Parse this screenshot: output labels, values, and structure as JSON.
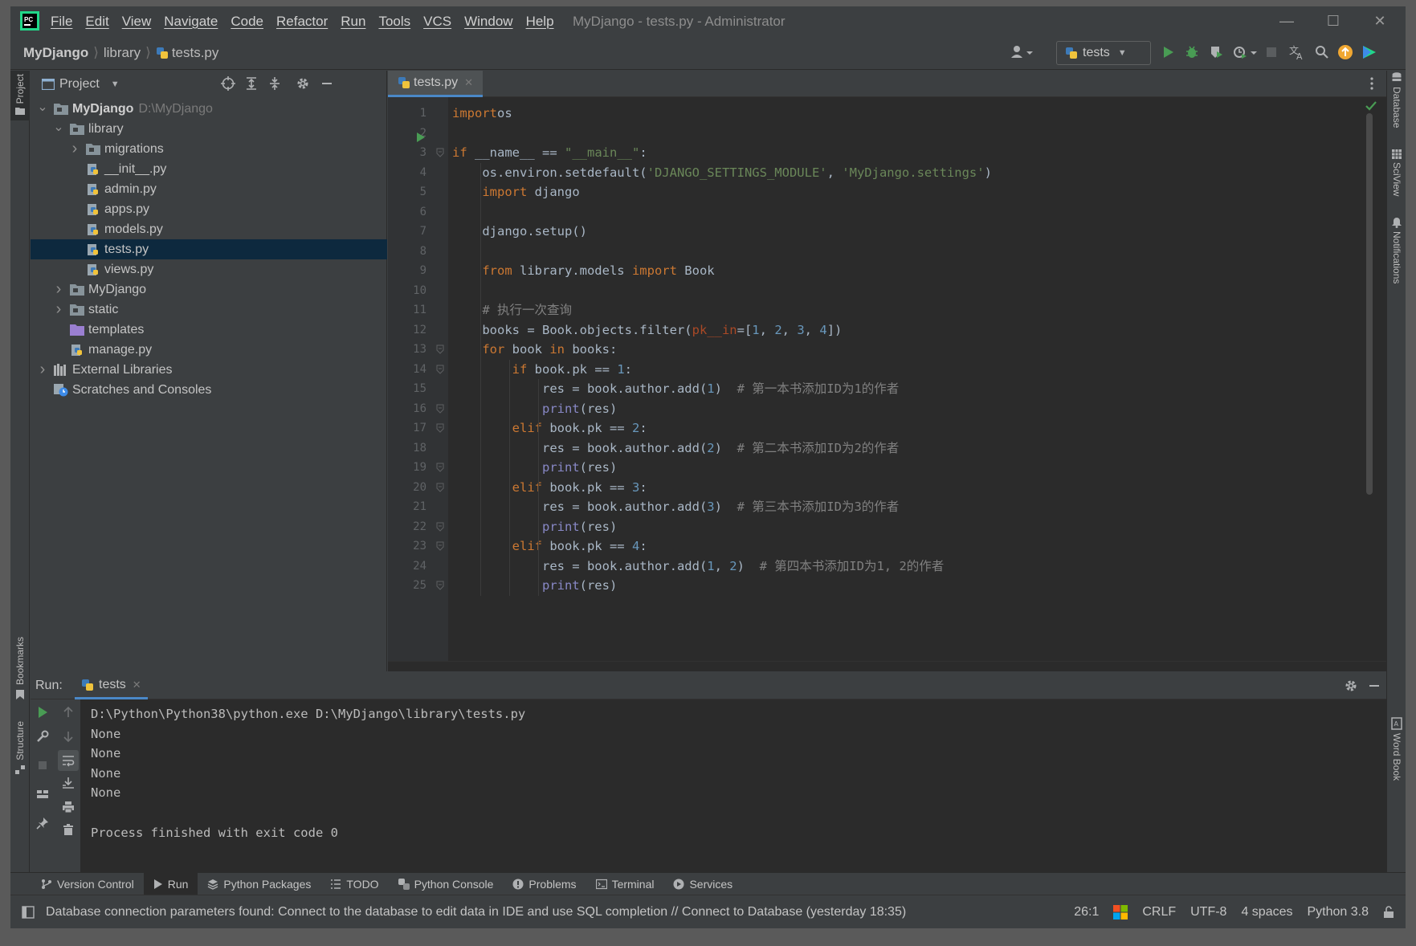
{
  "menu": [
    "File",
    "Edit",
    "View",
    "Navigate",
    "Code",
    "Refactor",
    "Run",
    "Tools",
    "VCS",
    "Window",
    "Help"
  ],
  "window_title": "MyDjango - tests.py - Administrator",
  "breadcrumb": [
    "MyDjango",
    "library",
    "tests.py"
  ],
  "run_config": "tests",
  "side_left": {
    "project": "Project",
    "bookmarks": "Bookmarks",
    "structure": "Structure"
  },
  "side_right": {
    "database": "Database",
    "sciview": "SciView",
    "notifications": "Notifications",
    "wordbook": "Word Book"
  },
  "project_panel": {
    "title": "Project"
  },
  "tree": [
    {
      "label": "MyDjango",
      "hint": "D:\\MyDjango",
      "depth": 0,
      "arrow": "down",
      "icon": "folder",
      "bold": true
    },
    {
      "label": "library",
      "depth": 1,
      "arrow": "down",
      "icon": "folder"
    },
    {
      "label": "migrations",
      "depth": 2,
      "arrow": "right",
      "icon": "folder"
    },
    {
      "label": "__init__.py",
      "depth": 2,
      "arrow": "",
      "icon": "py"
    },
    {
      "label": "admin.py",
      "depth": 2,
      "arrow": "",
      "icon": "py"
    },
    {
      "label": "apps.py",
      "depth": 2,
      "arrow": "",
      "icon": "py"
    },
    {
      "label": "models.py",
      "depth": 2,
      "arrow": "",
      "icon": "py"
    },
    {
      "label": "tests.py",
      "depth": 2,
      "arrow": "",
      "icon": "py",
      "selected": true
    },
    {
      "label": "views.py",
      "depth": 2,
      "arrow": "",
      "icon": "py"
    },
    {
      "label": "MyDjango",
      "depth": 1,
      "arrow": "right",
      "icon": "folder"
    },
    {
      "label": "static",
      "depth": 1,
      "arrow": "right",
      "icon": "folder"
    },
    {
      "label": "templates",
      "depth": 1,
      "arrow": "",
      "icon": "folder-purple"
    },
    {
      "label": "manage.py",
      "depth": 1,
      "arrow": "",
      "icon": "py"
    },
    {
      "label": "External Libraries",
      "depth": 0,
      "arrow": "right",
      "icon": "lib"
    },
    {
      "label": "Scratches and Consoles",
      "depth": 0,
      "arrow": "",
      "icon": "scratch"
    }
  ],
  "editor_tab": "tests.py",
  "code_lines": [
    {
      "n": "1",
      "tokens": [
        [
          "kw",
          "import"
        ],
        [
          "",
          "os"
        ]
      ]
    },
    {
      "n": "2",
      "tokens": []
    },
    {
      "n": "3",
      "tokens": [
        [
          "kw",
          "if"
        ],
        [
          "",
          " __name__ == "
        ],
        [
          "st",
          "\"__main__\""
        ],
        [
          "",
          ":"
        ]
      ]
    },
    {
      "n": "4",
      "tokens": [
        [
          "",
          "    os.environ.setdefault("
        ],
        [
          "st",
          "'DJANGO_SETTINGS_MODULE'"
        ],
        [
          "",
          ", "
        ],
        [
          "st",
          "'MyDjango.settings'"
        ],
        [
          "",
          ")"
        ]
      ]
    },
    {
      "n": "5",
      "tokens": [
        [
          "kw",
          "    import"
        ],
        [
          "",
          " django"
        ]
      ]
    },
    {
      "n": "6",
      "tokens": []
    },
    {
      "n": "7",
      "tokens": [
        [
          "",
          "    django.setup()"
        ]
      ]
    },
    {
      "n": "8",
      "tokens": []
    },
    {
      "n": "9",
      "tokens": [
        [
          "kw",
          "    from"
        ],
        [
          "",
          " library.models "
        ],
        [
          "kw",
          "import"
        ],
        [
          "",
          " Book"
        ]
      ]
    },
    {
      "n": "10",
      "tokens": []
    },
    {
      "n": "11",
      "tokens": [
        [
          "cm",
          "    # 执行一次查询"
        ]
      ]
    },
    {
      "n": "12",
      "tokens": [
        [
          "",
          "    books = Book.objects.filter("
        ],
        [
          "pa",
          "pk__in"
        ],
        [
          "",
          "=["
        ],
        [
          "nm",
          "1"
        ],
        [
          "",
          ", "
        ],
        [
          "nm",
          "2"
        ],
        [
          "",
          ", "
        ],
        [
          "nm",
          "3"
        ],
        [
          "",
          ", "
        ],
        [
          "nm",
          "4"
        ],
        [
          "",
          "])"
        ]
      ]
    },
    {
      "n": "13",
      "tokens": [
        [
          "kw",
          "    for"
        ],
        [
          "",
          " book "
        ],
        [
          "kw",
          "in"
        ],
        [
          "",
          " books:"
        ]
      ]
    },
    {
      "n": "14",
      "tokens": [
        [
          "kw",
          "        if"
        ],
        [
          "",
          " book.pk == "
        ],
        [
          "nm",
          "1"
        ],
        [
          "",
          ":"
        ]
      ]
    },
    {
      "n": "15",
      "tokens": [
        [
          "",
          "            res = book.author.add("
        ],
        [
          "nm",
          "1"
        ],
        [
          "",
          ")  "
        ],
        [
          "cm",
          "# 第一本书添加ID为1的作者"
        ]
      ]
    },
    {
      "n": "16",
      "tokens": [
        [
          "bi",
          "            print"
        ],
        [
          "",
          "(res)"
        ]
      ]
    },
    {
      "n": "17",
      "tokens": [
        [
          "kw",
          "        elif"
        ],
        [
          "",
          " book.pk == "
        ],
        [
          "nm",
          "2"
        ],
        [
          "",
          ":"
        ]
      ]
    },
    {
      "n": "18",
      "tokens": [
        [
          "",
          "            res = book.author.add("
        ],
        [
          "nm",
          "2"
        ],
        [
          "",
          ")  "
        ],
        [
          "cm",
          "# 第二本书添加ID为2的作者"
        ]
      ]
    },
    {
      "n": "19",
      "tokens": [
        [
          "bi",
          "            print"
        ],
        [
          "",
          "(res)"
        ]
      ]
    },
    {
      "n": "20",
      "tokens": [
        [
          "kw",
          "        elif"
        ],
        [
          "",
          " book.pk == "
        ],
        [
          "nm",
          "3"
        ],
        [
          "",
          ":"
        ]
      ]
    },
    {
      "n": "21",
      "tokens": [
        [
          "",
          "            res = book.author.add("
        ],
        [
          "nm",
          "3"
        ],
        [
          "",
          ")  "
        ],
        [
          "cm",
          "# 第三本书添加ID为3的作者"
        ]
      ]
    },
    {
      "n": "22",
      "tokens": [
        [
          "bi",
          "            print"
        ],
        [
          "",
          "(res)"
        ]
      ]
    },
    {
      "n": "23",
      "tokens": [
        [
          "kw",
          "        elif"
        ],
        [
          "",
          " book.pk == "
        ],
        [
          "nm",
          "4"
        ],
        [
          "",
          ":"
        ]
      ]
    },
    {
      "n": "24",
      "tokens": [
        [
          "",
          "            res = book.author.add("
        ],
        [
          "nm",
          "1"
        ],
        [
          "",
          ", "
        ],
        [
          "nm",
          "2"
        ],
        [
          "",
          ")  "
        ],
        [
          "cm",
          "# 第四本书添加ID为1, 2的作者"
        ]
      ]
    },
    {
      "n": "25",
      "tokens": [
        [
          "bi",
          "            print"
        ],
        [
          "",
          "(res)"
        ]
      ]
    }
  ],
  "run_panel": {
    "label": "Run:",
    "tab": "tests"
  },
  "console_lines": [
    "D:\\Python\\Python38\\python.exe D:\\MyDjango\\library\\tests.py",
    "None",
    "None",
    "None",
    "None",
    "",
    "Process finished with exit code 0"
  ],
  "tool_tabs": [
    {
      "label": "Version Control",
      "icon": "vcs-icon"
    },
    {
      "label": "Run",
      "icon": "run-icon",
      "active": true
    },
    {
      "label": "Python Packages",
      "icon": "packages-icon"
    },
    {
      "label": "TODO",
      "icon": "todo-icon"
    },
    {
      "label": "Python Console",
      "icon": "python-console-icon"
    },
    {
      "label": "Problems",
      "icon": "problems-icon"
    },
    {
      "label": "Terminal",
      "icon": "terminal-icon"
    },
    {
      "label": "Services",
      "icon": "services-icon"
    }
  ],
  "status": {
    "message": "Database connection parameters found: Connect to the database to edit data in IDE and use SQL completion // Connect to Database (yesterday 18:35)",
    "position": "26:1",
    "line_sep": "CRLF",
    "encoding": "UTF-8",
    "indent": "4 spaces",
    "interpreter": "Python 3.8"
  },
  "colors": {
    "accent": "#4a88c7",
    "selection": "#0d293e",
    "run_green": "#499c54",
    "keyword": "#cc7832",
    "string": "#6a8759",
    "number": "#6897bb",
    "comment": "#808080",
    "builtin": "#8888c6",
    "param": "#aa4926"
  }
}
